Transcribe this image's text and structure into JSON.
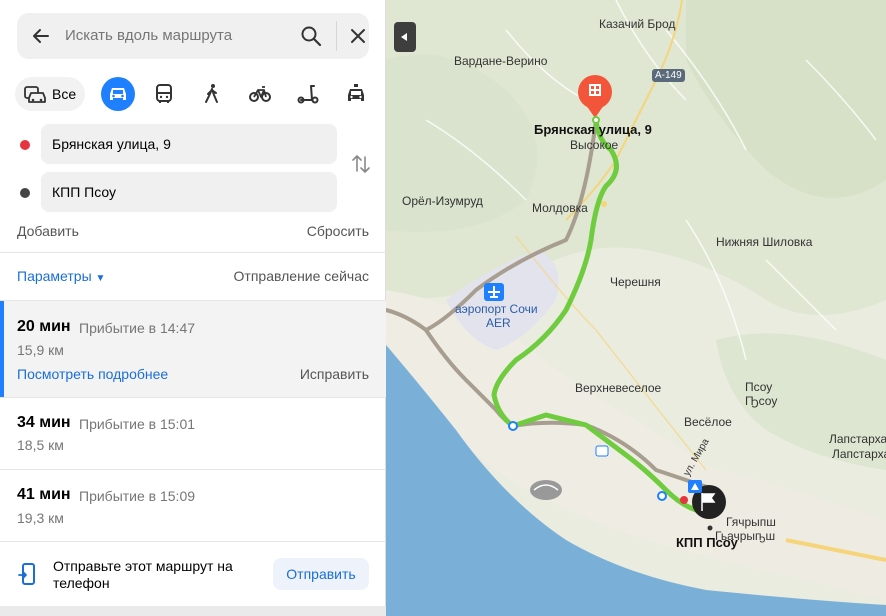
{
  "search": {
    "placeholder": "Искать вдоль маршрута"
  },
  "modes": {
    "all_label": "Все",
    "items": [
      "car-icon",
      "bus-icon",
      "pedestrian-icon",
      "bicycle-icon",
      "scooter-icon",
      "taxi-icon"
    ],
    "active": "car-icon",
    "active_color": "#1e80ff"
  },
  "route_points": {
    "from": "Брянская улица, 9",
    "from_color": "#e8343e",
    "to": "КПП Псоу",
    "to_color": "#444444"
  },
  "actions": {
    "add": "Добавить",
    "reset": "Сбросить"
  },
  "options": {
    "params": "Параметры",
    "departure": "Отправление сейчас"
  },
  "routes": [
    {
      "time": "20 мин",
      "arrival": "Прибытие в 14:47",
      "distance": "15,9 км",
      "details": "Посмотреть подробнее",
      "fix": "Исправить"
    },
    {
      "time": "34 мин",
      "arrival": "Прибытие в 15:01",
      "distance": "18,5 км"
    },
    {
      "time": "41 мин",
      "arrival": "Прибытие в 15:09",
      "distance": "19,3 км"
    }
  ],
  "send": {
    "text": "Отправьте этот маршрут на телефон",
    "button": "Отправить"
  },
  "map": {
    "labels": {
      "kazachiy": "Казачий Брод",
      "vardane": "Вардане-Верино",
      "hw": "А-149",
      "start": "Брянская улица, 9",
      "vysokoe": "Высокое",
      "orel": "Орёл-Изумруд",
      "moldovka": "Молдовка",
      "shilovka": "Нижняя Шиловка",
      "chereshnya": "Черешня",
      "airport": "аэропорт Сочи",
      "aer": "AER",
      "verkhnevesyoloe": "Верхневеселое",
      "psou1": "Псоу",
      "psou2": "Ҧсоу",
      "vesyoloe": "Весёлое",
      "lapstarha1": "Лапстарха",
      "lapstarha2": "Лапстарха",
      "mira": "ул. Мира",
      "gyachrypsh1": "Гячрыпш",
      "gyachrypsh2": "Гьачрыҧш",
      "kpp": "КПП Псоу"
    },
    "route_color": "#6fcc3e",
    "alt_route_color": "#a79e8f",
    "sea_color": "#7ab0d8"
  }
}
